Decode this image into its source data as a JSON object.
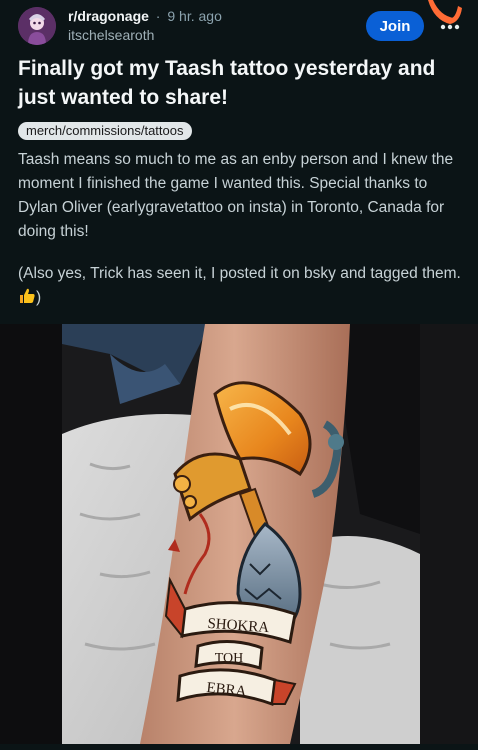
{
  "header": {
    "subreddit": "r/dragonage",
    "separator": "·",
    "time_ago": "9 hr. ago",
    "author": "itschelsearoth",
    "join_label": "Join",
    "more_icon": "more-dots-icon"
  },
  "post": {
    "title": "Finally got my Taash tattoo yesterday and just wanted to share!",
    "flair": "merch/commissions/tattoos",
    "body_paragraph_1": "Taash means so much to me as an enby person and I knew the moment I finished the game I wanted this. Special thanks to Dylan Oliver (earlygravetattoo on insta) in Toronto, Canada for doing this!",
    "body_paragraph_2_start": "(Also yes, Trick has seen it, I posted it on bsky and tagged them. ",
    "body_paragraph_2_end": ")"
  },
  "image": {
    "description_icon": "tattoo-photo",
    "banner_lines": [
      "SHOKRA",
      "TOH",
      "EBRA"
    ]
  },
  "colors": {
    "background": "#0b1416",
    "join_button": "#0a60d6",
    "flair_bg": "#e2e7e9",
    "accent_orange": "#ff6b35"
  }
}
